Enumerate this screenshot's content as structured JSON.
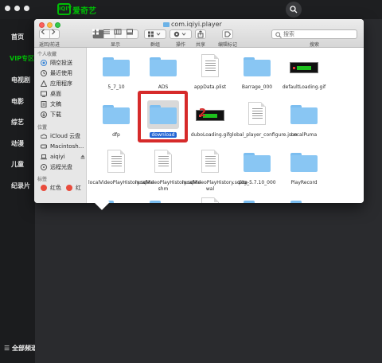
{
  "app": {
    "logo_mark": "iQIY",
    "logo_text": "爱奇艺",
    "nav": [
      "首页",
      "VIP专区",
      "电视剧",
      "电影",
      "综艺",
      "动漫",
      "儿童",
      "纪录片"
    ],
    "active_nav": "VIP专区",
    "all_channels": "☰ 全部频道",
    "accent": "#00be06"
  },
  "finder": {
    "title": "com.iqiyi.player",
    "toolbar": {
      "back_forward": "返回/前进",
      "view": "显示",
      "group": "群组",
      "action": "操作",
      "share": "共享",
      "tags": "编辑标记",
      "search": "搜索",
      "search_placeholder": "搜索"
    },
    "sidebar": {
      "favorites_header": "个人收藏",
      "favorites": [
        {
          "label": "隔空投送",
          "icon": "airdrop-icon"
        },
        {
          "label": "最近使用",
          "icon": "clock-icon"
        },
        {
          "label": "应用程序",
          "icon": "apps-icon"
        },
        {
          "label": "桌面",
          "icon": "desktop-icon"
        },
        {
          "label": "文稿",
          "icon": "document-icon"
        },
        {
          "label": "下载",
          "icon": "download-icon"
        }
      ],
      "locations_header": "位置",
      "locations": [
        {
          "label": "iCloud 云盘",
          "icon": "cloud-icon"
        },
        {
          "label": "Macintosh...",
          "icon": "disk-icon"
        },
        {
          "label": "aiqiyi",
          "icon": "laptop-icon"
        },
        {
          "label": "远程光盘",
          "icon": "disc-icon"
        }
      ],
      "tags_header": "标签",
      "tags": [
        {
          "label": "红色",
          "color": "#e94b3c"
        },
        {
          "label": "红",
          "color": "#e94b3c"
        }
      ]
    },
    "files": [
      {
        "name": "5_7_10",
        "kind": "folder"
      },
      {
        "name": "ADS",
        "kind": "folder"
      },
      {
        "name": "appData.plist",
        "kind": "doc"
      },
      {
        "name": "Barrage_000",
        "kind": "folder"
      },
      {
        "name": "defaultLoading.gif",
        "kind": "gif"
      },
      {
        "name": "dfp",
        "kind": "folder"
      },
      {
        "name": "download",
        "kind": "folder",
        "selected": true
      },
      {
        "name": "duboLoading.gif",
        "kind": "gif"
      },
      {
        "name": "global_player_configure.json",
        "kind": "doc"
      },
      {
        "name": "LocalPuma",
        "kind": "folder"
      },
      {
        "name": "localVideoPlayHistory.sqlite",
        "kind": "doc"
      },
      {
        "name": "localVideoPlayHistory.sqlite-shm",
        "kind": "doc"
      },
      {
        "name": "localVideoPlayHistory.sqlite-wal",
        "kind": "doc"
      },
      {
        "name": "Log_5.7.10_000",
        "kind": "folder"
      },
      {
        "name": "PlayRecord",
        "kind": "folder"
      },
      {
        "name": "",
        "kind": "folder"
      },
      {
        "name": "",
        "kind": "folder"
      },
      {
        "name": "",
        "kind": "doc"
      },
      {
        "name": "",
        "kind": "folder"
      },
      {
        "name": "",
        "kind": "folder"
      }
    ],
    "annotation_number": "2",
    "highlight_color": "#d62a2a"
  }
}
